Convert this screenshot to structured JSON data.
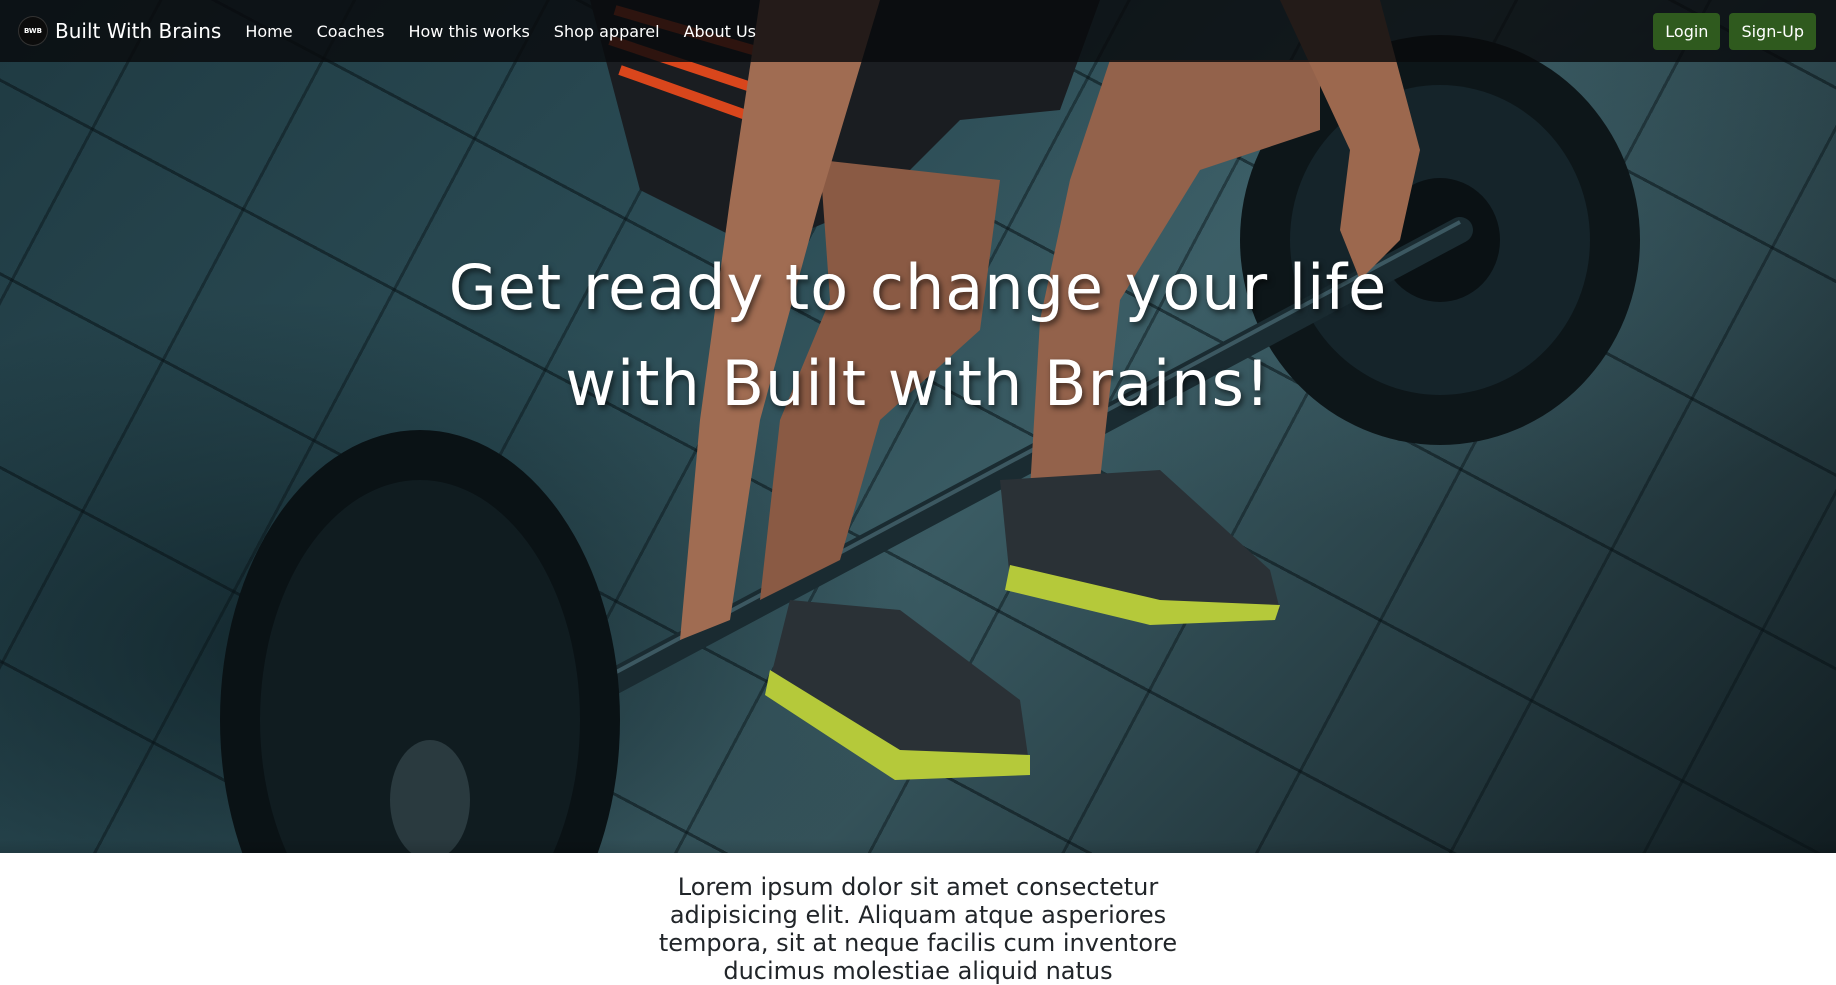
{
  "navbar": {
    "brand_name": "Built With Brains",
    "logo_text": "BWB",
    "links": [
      {
        "label": "Home"
      },
      {
        "label": "Coaches"
      },
      {
        "label": "How this works"
      },
      {
        "label": "Shop apparel"
      },
      {
        "label": "About Us"
      }
    ],
    "login_label": "Login",
    "signup_label": "Sign-Up"
  },
  "hero": {
    "headline_line1": "Get ready to change your life",
    "headline_line2": "with Built with Brains!"
  },
  "main": {
    "intro_text": "Lorem ipsum dolor sit amet consectetur adipisicing elit. Aliquam atque asperiores tempora, sit at neque facilis cum inventore ducimus molestiae aliquid natus"
  },
  "colors": {
    "button_bg": "#2f5a1e",
    "navbar_bg": "#080a0c",
    "hero_floor": "#2b4c55"
  }
}
